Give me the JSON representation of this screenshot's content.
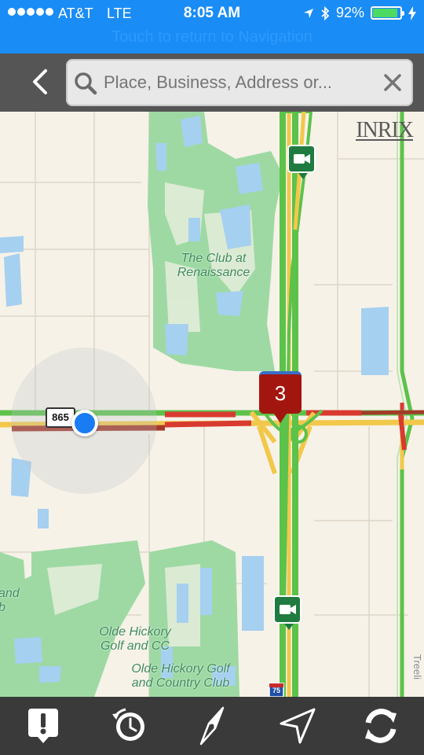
{
  "status_bar": {
    "carrier": "AT&T",
    "network": "LTE",
    "time": "8:05 AM",
    "battery_pct": "92%",
    "battery_level": 0.92,
    "return_banner": "Touch to return to Navigation"
  },
  "search": {
    "placeholder": "Place, Business, Address or..."
  },
  "map": {
    "labels": {
      "club_renaissance": "The Club at Renaissance",
      "olde_hickory_cc": "Olde Hickory Golf and CC",
      "olde_hickory_club": "Olde Hickory Golf and Country Club",
      "and_b": "and b",
      "route_shield": "865",
      "interstate": "75",
      "side_road": "Treeli"
    },
    "provider": "INRIX",
    "incident_count": "3"
  },
  "toolbar": {
    "items": [
      "alert-icon",
      "history-clock-icon",
      "compass-icon",
      "navigate-arrow-icon",
      "refresh-icon"
    ]
  },
  "colors": {
    "status_bar": "#1a8cf5",
    "search_bar": "#555555",
    "toolbar": "#3a3a3a",
    "map_background": "#f6f2e8",
    "park_green": "#9ed9a4",
    "water_blue": "#a6d0ef",
    "traffic_green": "#5cc24a",
    "traffic_yellow": "#f2c84b",
    "traffic_red": "#d93a2f",
    "incident_red": "#a3160f"
  }
}
